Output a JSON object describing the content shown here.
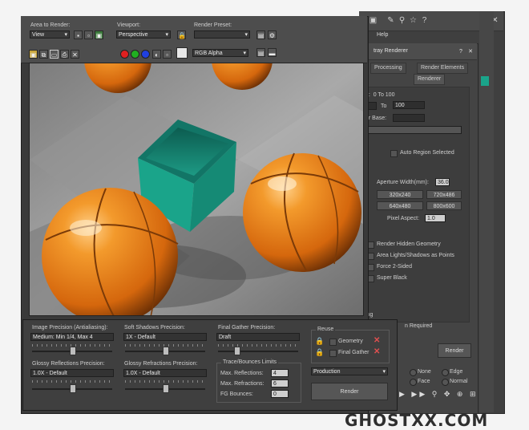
{
  "main_window": {
    "menu_help": "Help"
  },
  "render_setup": {
    "title": "Vray Renderer",
    "title_prefix": "tray Renderer",
    "tabs": [
      "Processing",
      "Render Elements",
      "Renderer"
    ],
    "range_label_a": "b:",
    "range_value": "0 To 100",
    "to_label": "To",
    "to_value": "100",
    "file_base_label": "er Base:",
    "auto_region": "Auto Region Selected",
    "aperture_label": "Aperture Width(mm):",
    "aperture_value": "36.0",
    "resolutions": [
      "320x240",
      "720x486",
      "640x480",
      "800x600"
    ],
    "pixel_aspect_label": "Pixel Aspect:",
    "pixel_aspect_value": "1.0",
    "options": [
      "Render Hidden Geometry",
      "Area Lights/Shadows as Points",
      "Force 2-Sided",
      "Super Black"
    ],
    "partial_text_1": "ing",
    "partial_text_2": "n Required",
    "render_label": "Render",
    "radio_none": "None",
    "radio_edge": "Edge",
    "radio_face": "Face",
    "radio_normal": "Normal"
  },
  "render_frame": {
    "area_to_render_label": "Area to Render:",
    "area_to_render_value": "View",
    "viewport_label": "Viewport:",
    "viewport_value": "Perspective",
    "render_preset_label": "Render Preset:",
    "render_preset_value": "",
    "channel_value": "RGB Alpha"
  },
  "bottom_panel": {
    "image_precision_label": "Image Precision (Antialiasing):",
    "image_precision_value": "Medium: Min 1/4, Max 4",
    "soft_shadows_label": "Soft Shadows Precision:",
    "soft_shadows_value": "1X - Default",
    "final_gather_label": "Final Gather Precision:",
    "final_gather_value": "Draft",
    "glossy_refl_label": "Glossy Reflections Precision:",
    "glossy_refl_value": "1.0X - Default",
    "glossy_refr_label": "Glossy Refractions Precision:",
    "glossy_refr_value": "1.0X - Default",
    "trace_label": "Trace/Bounces Limits",
    "max_reflections_label": "Max. Reflections:",
    "max_reflections_value": "4",
    "max_refractions_label": "Max. Refractions:",
    "max_refractions_value": "6",
    "fg_bounces_label": "FG Bounces:",
    "fg_bounces_value": "0",
    "reuse_label": "Reuse",
    "geometry_label": "Geometry",
    "final_gather_reuse_label": "Final Gather",
    "production_value": "Production",
    "render_button": "Render"
  },
  "watermark": "GHOSTXX.COM",
  "colors": {
    "teal": "#1aa48a",
    "sphere_orange": "#e9821d",
    "box_teal": "#178f7a"
  }
}
